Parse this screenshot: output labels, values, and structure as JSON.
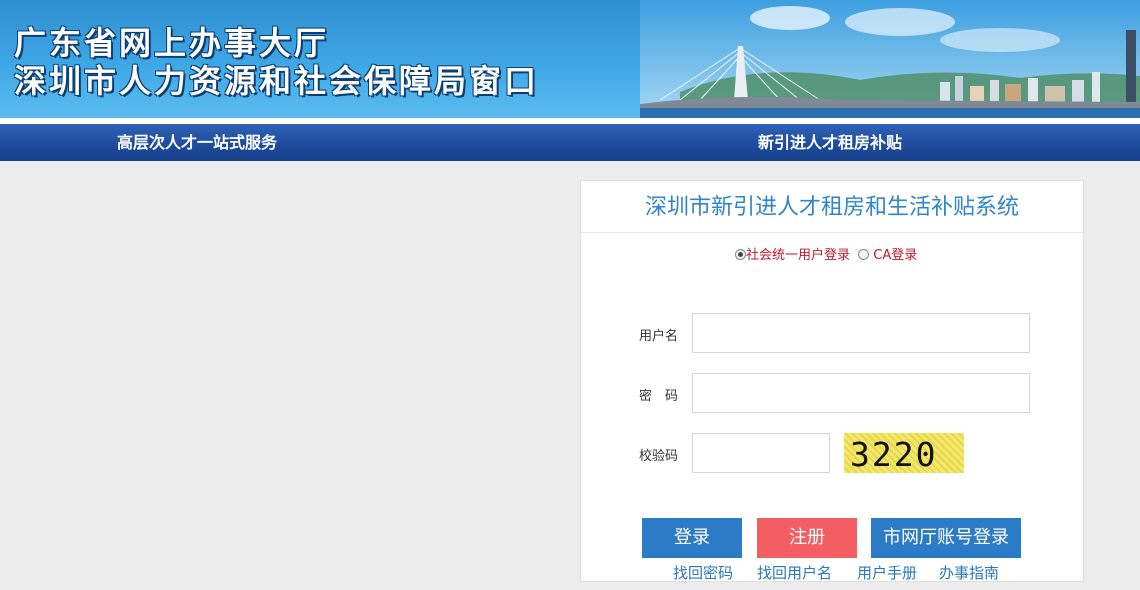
{
  "header": {
    "title_line1": "广东省网上办事大厅",
    "title_line2": "深圳市人力资源和社会保障局窗口"
  },
  "nav": {
    "items": [
      {
        "label": "高层次人才一站式服务"
      },
      {
        "label": "新引进人才租房补贴"
      }
    ]
  },
  "login": {
    "title": "深圳市新引进人才租房和生活补贴系统",
    "modes": [
      {
        "label": "社会统一用户登录",
        "checked": true
      },
      {
        "label": "CA登录",
        "checked": false
      }
    ],
    "fields": {
      "username_label": "用户名",
      "username_value": "",
      "password_label": "密　码",
      "password_value": "",
      "captcha_label": "校验码",
      "captcha_value": "",
      "captcha_image_text": "3220"
    },
    "buttons": {
      "login": "登录",
      "register": "注册",
      "city_account": "市网厅账号登录"
    },
    "links": [
      {
        "label": "找回密码"
      },
      {
        "label": "找回用户名"
      },
      {
        "label": "用户手册"
      },
      {
        "label": "办事指南"
      }
    ]
  },
  "colors": {
    "nav_bg": "#1d4a9a",
    "title_blue": "#2f86c8",
    "button_blue": "#2b7bc6",
    "button_red": "#f25e62",
    "mode_red": "#c0192b",
    "link_blue": "#2a77bd"
  }
}
